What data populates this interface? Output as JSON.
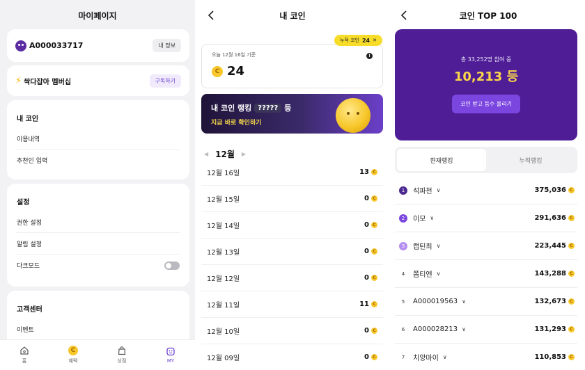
{
  "screen1": {
    "title": "마이페이지",
    "user_id": "A000033717",
    "profile_button": "내 정보",
    "membership_label": "싹다잡아 멤버십",
    "subscribe_button": "구독하기",
    "mycoin_section": {
      "title": "내 코인",
      "items": [
        "이용내역",
        "추천인 입력"
      ]
    },
    "settings_section": {
      "title": "설정",
      "items": [
        "권한 설정",
        "알림 설정",
        "다크모드"
      ]
    },
    "support_section": {
      "title": "고객센터",
      "items": [
        "이벤트"
      ]
    },
    "tabbar": [
      {
        "label": "홈",
        "icon": "home-icon"
      },
      {
        "label": "혜택",
        "icon": "coin-icon"
      },
      {
        "label": "상점",
        "icon": "shopping-bag-icon"
      },
      {
        "label": "MY",
        "icon": "my-face-icon",
        "active": true
      }
    ]
  },
  "screen2": {
    "title": "내 코인",
    "accumulated_label": "누적 코인",
    "accumulated_value": "24",
    "balance_date": "오늘 12월 16일 기준",
    "balance_value": "24",
    "coin_glyph": "C",
    "banner": {
      "line1_prefix": "내 코인 랭킹",
      "rank_placeholder": "?????",
      "line1_suffix": "등",
      "cta": "지금 바로 확인하기"
    },
    "month": "12월",
    "daily": [
      {
        "date": "12월 16일",
        "value": "13"
      },
      {
        "date": "12월 15일",
        "value": "0"
      },
      {
        "date": "12월 14일",
        "value": "0"
      },
      {
        "date": "12월 13일",
        "value": "0"
      },
      {
        "date": "12월 12일",
        "value": "0"
      },
      {
        "date": "12월 11일",
        "value": "11"
      },
      {
        "date": "12월 10일",
        "value": "0"
      },
      {
        "date": "12월 09일",
        "value": "0"
      }
    ]
  },
  "screen3": {
    "title": "코인 TOP 100",
    "participants": "총 33,252명 참여 중",
    "my_rank": "10,213 등",
    "cta_button": "코인 받고 등수 올리기",
    "tabs": [
      "현재랭킹",
      "누적랭킹"
    ],
    "ranking": [
      {
        "rank": "1",
        "name": "석파천",
        "score": "375,036",
        "color": "#4c2a91"
      },
      {
        "rank": "2",
        "name": "이모",
        "score": "291,636",
        "color": "#7a48de"
      },
      {
        "rank": "3",
        "name": "캡틴최",
        "score": "223,445",
        "color": "#b48ef0"
      },
      {
        "rank": "4",
        "name": "쫌티엔",
        "score": "143,288"
      },
      {
        "rank": "5",
        "name": "A000019563",
        "score": "132,673"
      },
      {
        "rank": "6",
        "name": "A000028213",
        "score": "131,293"
      },
      {
        "rank": "7",
        "name": "치앙마이",
        "score": "110,853"
      }
    ]
  },
  "colors": {
    "accent": "#6a3fd0",
    "hero_bg": "#4f1d96",
    "coin": "#f7c72b",
    "rank_gold": "#fbd64a"
  }
}
